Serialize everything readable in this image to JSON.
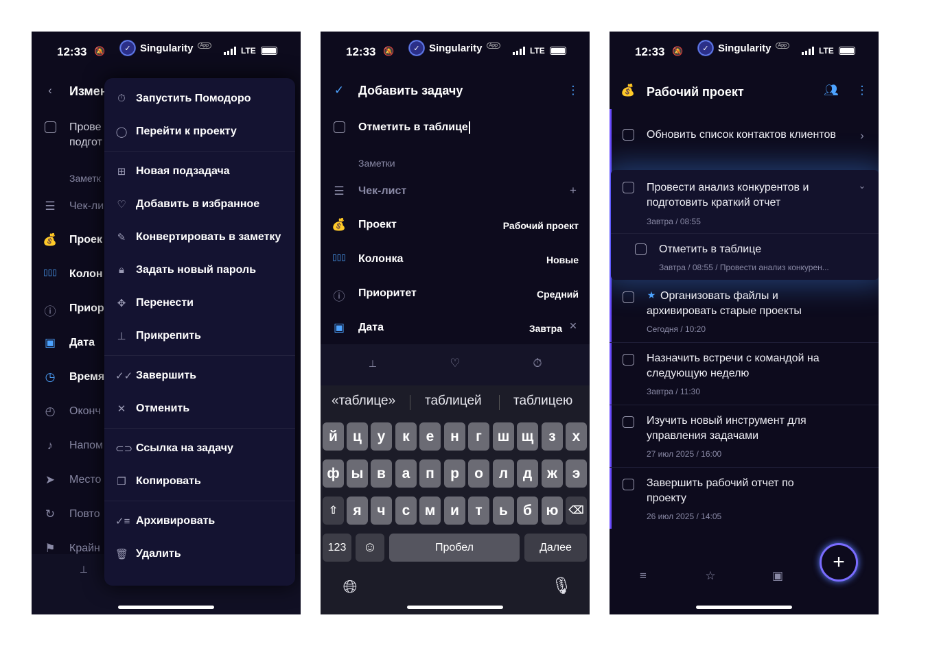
{
  "status": {
    "time": "12:33",
    "app_name": "Singularity",
    "app_tag": "App",
    "network": "LTE"
  },
  "phone1": {
    "header_title": "Измен",
    "task_text": [
      "Прове",
      "подгот"
    ],
    "notes_label": "Заметк",
    "rows": [
      {
        "icon": "checklist-icon",
        "label": "Чек-ли"
      },
      {
        "icon": "money-bag-icon",
        "label": "Проек"
      },
      {
        "icon": "columns-icon",
        "label": "Колон"
      },
      {
        "icon": "priority-icon",
        "label": "Приор"
      },
      {
        "icon": "calendar-icon",
        "label": "Дата"
      },
      {
        "icon": "clock-icon",
        "label": "Время"
      },
      {
        "icon": "end-time-icon",
        "label": "Оконч"
      },
      {
        "icon": "bell-icon",
        "label": "Напом"
      },
      {
        "icon": "location-icon",
        "label": "Место"
      },
      {
        "icon": "repeat-icon",
        "label": "Повто"
      },
      {
        "icon": "flag-icon",
        "label": "Крайн"
      }
    ],
    "menu": [
      {
        "icon": "timer-icon",
        "label": "Запустить Помодоро"
      },
      {
        "icon": "circle-icon",
        "label": "Перейти к проекту"
      },
      {
        "icon": "plus-square-icon",
        "label": "Новая подзадача"
      },
      {
        "icon": "heart-icon",
        "label": "Добавить в избранное"
      },
      {
        "icon": "note-icon",
        "label": "Конвертировать в заметку"
      },
      {
        "icon": "lock-icon",
        "label": "Задать новый пароль"
      },
      {
        "icon": "move-icon",
        "label": "Перенести"
      },
      {
        "icon": "pin-icon",
        "label": "Прикрепить"
      },
      {
        "icon": "check-double-icon",
        "label": "Завершить"
      },
      {
        "icon": "close-icon",
        "label": "Отменить"
      },
      {
        "icon": "link-icon",
        "label": "Ссылка на задачу"
      },
      {
        "icon": "copy-icon",
        "label": "Копировать"
      },
      {
        "icon": "archive-icon",
        "label": "Архивировать"
      },
      {
        "icon": "trash-icon",
        "label": "Удалить"
      }
    ]
  },
  "phone2": {
    "header_title": "Добавить задачу",
    "task_input": "Отметить в таблице",
    "notes_placeholder": "Заметки",
    "checklist_label": "Чек-лист",
    "fields": [
      {
        "icon": "money-bag-icon",
        "label": "Проект",
        "value": "Рабочий проект"
      },
      {
        "icon": "columns-icon",
        "label": "Колонка",
        "value": "Новые"
      },
      {
        "icon": "priority-icon",
        "label": "Приоритет",
        "value": "Средний"
      },
      {
        "icon": "calendar-icon",
        "label": "Дата",
        "value": "Завтра"
      }
    ],
    "suggestions": [
      "«таблице»",
      "таблицей",
      "таблицею"
    ],
    "keyboard": {
      "row1": [
        "й",
        "ц",
        "у",
        "к",
        "е",
        "н",
        "г",
        "ш",
        "щ",
        "з",
        "х"
      ],
      "row2": [
        "ф",
        "ы",
        "в",
        "а",
        "п",
        "р",
        "о",
        "л",
        "д",
        "ж",
        "э"
      ],
      "row3": [
        "я",
        "ч",
        "с",
        "м",
        "и",
        "т",
        "ь",
        "б",
        "ю"
      ],
      "num_key": "123",
      "space_key": "Пробел",
      "next_key": "Далее"
    }
  },
  "phone3": {
    "header_title": "Рабочий проект",
    "tasks": [
      {
        "title": "Обновить список контактов клиентов",
        "meta": ""
      },
      {
        "title": "Провести анализ конкурентов и подготовить краткий отчет",
        "meta": "Завтра / 08:55"
      },
      {
        "title": "Отметить в таблице",
        "meta": "Завтра / 08:55 / Провести анализ конкурен..."
      },
      {
        "title": "Организовать файлы и архивировать старые проекты",
        "meta": "Сегодня / 10:20"
      },
      {
        "title": "Назначить встречи с командой на следующую неделю",
        "meta": "Завтра / 11:30"
      },
      {
        "title": "Изучить новый инструмент для управления задачами",
        "meta": "27 июл 2025 / 16:00"
      },
      {
        "title": "Завершить рабочий отчет по проекту",
        "meta": "26 июл 2025 / 14:05"
      }
    ]
  }
}
